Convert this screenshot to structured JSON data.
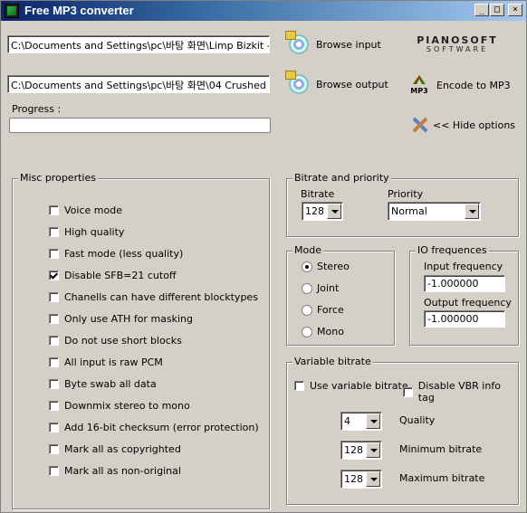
{
  "window": {
    "title": "Free MP3 converter"
  },
  "title_buttons": {
    "minimize": "_",
    "maximize": "□",
    "close": "×"
  },
  "inputs": {
    "input_path": "C:\\Documents and Settings\\pc\\바탕 화면\\Limp Bizkit - Get",
    "output_path": "C:\\Documents and Settings\\pc\\바탕 화면\\04 Crushed (Bos"
  },
  "buttons": {
    "browse_input": "Browse input",
    "browse_output": "Browse output",
    "encode": "Encode to MP3",
    "hide_options": "<< Hide options"
  },
  "logo": {
    "line1": "PIANOSOFT",
    "line2": "SOFTWARE"
  },
  "progress": {
    "label": "Progress :",
    "value": 0
  },
  "misc": {
    "title": "Misc properties",
    "items": [
      {
        "label": "Voice mode",
        "checked": false
      },
      {
        "label": "High quality",
        "checked": false
      },
      {
        "label": "Fast mode (less quality)",
        "checked": false
      },
      {
        "label": "Disable SFB=21 cutoff",
        "checked": true
      },
      {
        "label": "Chanells can have different blocktypes",
        "checked": false
      },
      {
        "label": "Only use ATH for masking",
        "checked": false
      },
      {
        "label": "Do not use short blocks",
        "checked": false
      },
      {
        "label": "All input is raw PCM",
        "checked": false
      },
      {
        "label": "Byte swab all data",
        "checked": false
      },
      {
        "label": "Downmix stereo to mono",
        "checked": false
      },
      {
        "label": "Add 16-bit checksum (error protection)",
        "checked": false
      },
      {
        "label": "Mark all as copyrighted",
        "checked": false
      },
      {
        "label": "Mark all as non-original",
        "checked": false
      }
    ]
  },
  "bitrate_priority": {
    "title": "Bitrate and priority",
    "bitrate_label": "Bitrate",
    "bitrate_value": "128",
    "priority_label": "Priority",
    "priority_value": "Normal"
  },
  "mode": {
    "title": "Mode",
    "options": [
      "Stereo",
      "Joint",
      "Force",
      "Mono"
    ],
    "selected": "Stereo"
  },
  "io": {
    "title": "IO frequences",
    "input_label": "Input frequency",
    "input_value": "-1.000000",
    "output_label": "Output frequency",
    "output_value": "-1.000000"
  },
  "vbr": {
    "title": "Variable bitrate",
    "use_vbr": "Use variable bitrate",
    "disable_tag": "Disable VBR info tag",
    "quality_value": "4",
    "quality_label": "Quality",
    "min_value": "128",
    "min_label": "Minimum bitrate",
    "max_value": "128",
    "max_label": "Maximum bitrate"
  }
}
